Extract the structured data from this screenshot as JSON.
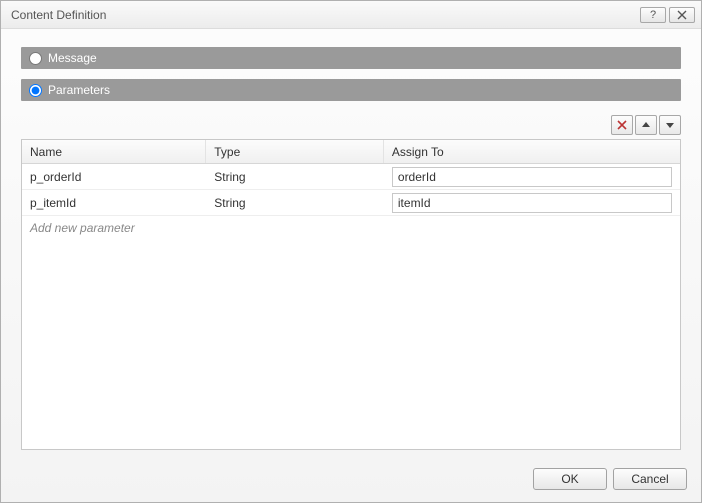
{
  "dialog": {
    "title": "Content Definition"
  },
  "options": {
    "message_label": "Message",
    "parameters_label": "Parameters",
    "message_selected": false,
    "parameters_selected": true
  },
  "toolbar": {
    "delete_icon": "delete-icon",
    "up_icon": "arrow-up-icon",
    "down_icon": "arrow-down-icon"
  },
  "table": {
    "headers": {
      "name": "Name",
      "type": "Type",
      "assign": "Assign To"
    },
    "rows": [
      {
        "name": "p_orderId",
        "type": "String",
        "assign": "orderId"
      },
      {
        "name": "p_itemId",
        "type": "String",
        "assign": "itemId"
      }
    ],
    "add_placeholder": "Add new parameter"
  },
  "buttons": {
    "ok": "OK",
    "cancel": "Cancel"
  },
  "titlebar": {
    "help_icon": "help-icon",
    "close_icon": "close-icon"
  }
}
